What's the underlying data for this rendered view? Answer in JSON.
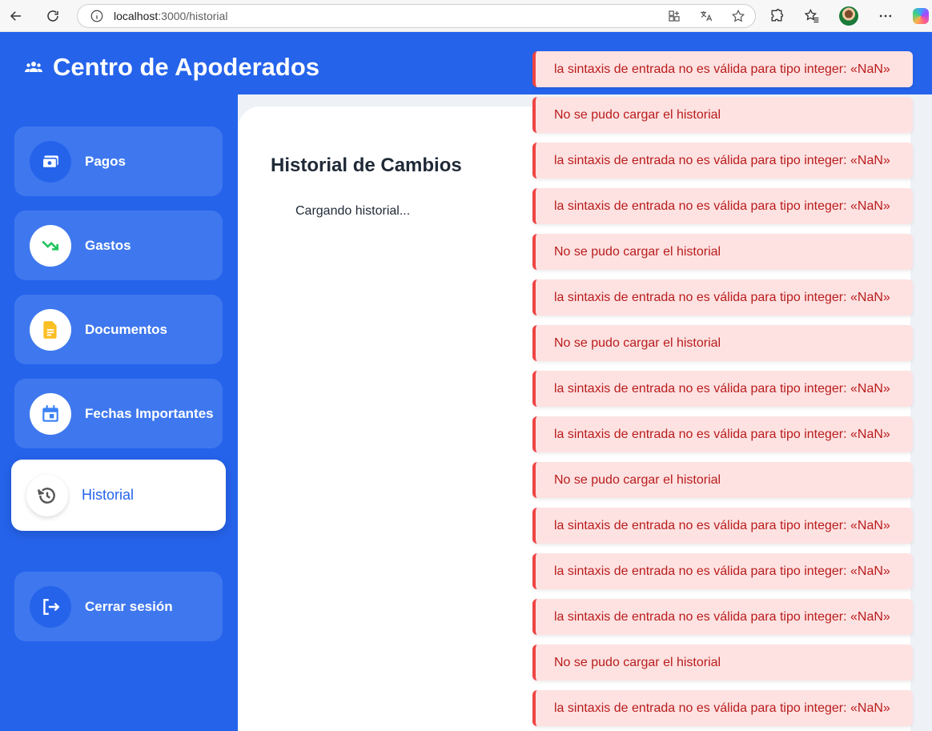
{
  "browser": {
    "url_host": "localhost",
    "url_path": ":3000/historial"
  },
  "app": {
    "title": "Centro de Apoderados"
  },
  "sidebar": {
    "items": [
      {
        "label": "Pagos",
        "icon": "cash-icon",
        "color": "#2563eb"
      },
      {
        "label": "Gastos",
        "icon": "trending-down-icon",
        "color": "#22c55e"
      },
      {
        "label": "Documentos",
        "icon": "document-icon",
        "color": "#fbbf24"
      },
      {
        "label": "Fechas Importantes",
        "icon": "calendar-icon",
        "color": "#3b82f6"
      },
      {
        "label": "Historial",
        "icon": "history-icon",
        "color": "#555555"
      },
      {
        "label": "Cerrar sesión",
        "icon": "logout-icon",
        "color": "#2563eb"
      }
    ]
  },
  "main": {
    "title": "Historial de Cambios",
    "loading_text": "Cargando historial..."
  },
  "toasts": [
    "la sintaxis de entrada no es válida para tipo integer: «NaN»",
    "No se pudo cargar el historial",
    "la sintaxis de entrada no es válida para tipo integer: «NaN»",
    "la sintaxis de entrada no es válida para tipo integer: «NaN»",
    "No se pudo cargar el historial",
    "la sintaxis de entrada no es válida para tipo integer: «NaN»",
    "No se pudo cargar el historial",
    "la sintaxis de entrada no es válida para tipo integer: «NaN»",
    "la sintaxis de entrada no es válida para tipo integer: «NaN»",
    "No se pudo cargar el historial",
    "la sintaxis de entrada no es válida para tipo integer: «NaN»",
    "la sintaxis de entrada no es válida para tipo integer: «NaN»",
    "la sintaxis de entrada no es válida para tipo integer: «NaN»",
    "No se pudo cargar el historial",
    "la sintaxis de entrada no es válida para tipo integer: «NaN»"
  ],
  "colors": {
    "primary": "#2563eb",
    "toast_bg": "#fee2e2",
    "toast_text": "#b91c1c",
    "toast_border": "#ef4444"
  }
}
